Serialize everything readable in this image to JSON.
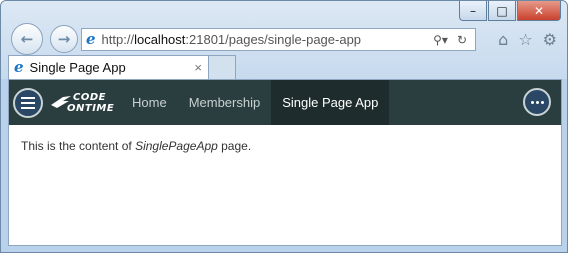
{
  "browser": {
    "url_prefix": "http://",
    "url_host": "localhost",
    "url_rest": ":21801/pages/single-page-app",
    "tab_title": "Single Page App",
    "tab_close": "×",
    "window_buttons": {
      "minimize": "–",
      "maximize": "□",
      "close": "✕"
    }
  },
  "app": {
    "logo_line1": "CODE",
    "logo_line2": "ONTIME",
    "nav": [
      {
        "label": "Home",
        "active": false
      },
      {
        "label": "Membership",
        "active": false
      },
      {
        "label": "Single Page App",
        "active": true
      }
    ],
    "content": {
      "before": "This is the content of ",
      "emphasis": "SinglePageApp",
      "after": " page."
    }
  },
  "icons": {
    "back": "arrow-left-icon",
    "forward": "arrow-right-icon",
    "search": "search-icon",
    "refresh": "refresh-icon",
    "home": "home-icon",
    "favorites": "star-icon",
    "tools": "gear-icon",
    "menu": "hamburger-icon",
    "more": "more-dots-icon"
  },
  "colors": {
    "appbar": "#2b3e3f",
    "active_nav": "#1e2c2d",
    "round_button": "#2a4766"
  }
}
